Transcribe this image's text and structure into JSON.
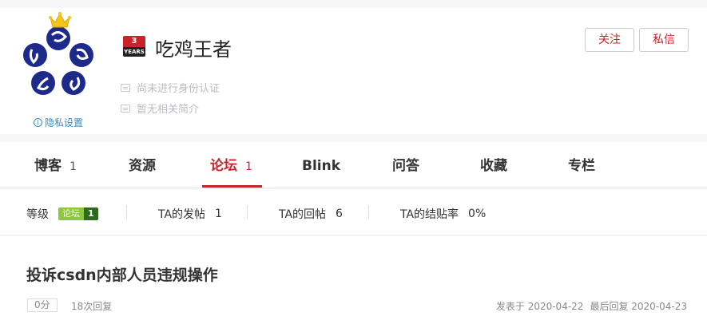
{
  "profile": {
    "username": "吃鸡王者",
    "years_badge": {
      "number": "3",
      "label": "YEARS"
    },
    "verification": "尚未进行身份认证",
    "bio": "暂无相关简介",
    "privacy": "隐私设置",
    "follow_button": "关注",
    "message_button": "私信"
  },
  "tabs": [
    {
      "label": "博客",
      "count": "1"
    },
    {
      "label": "资源",
      "count": ""
    },
    {
      "label": "论坛",
      "count": "1",
      "active": true
    },
    {
      "label": "Blink",
      "count": ""
    },
    {
      "label": "问答",
      "count": ""
    },
    {
      "label": "收藏",
      "count": ""
    },
    {
      "label": "专栏",
      "count": ""
    }
  ],
  "stats": {
    "level_label": "等级",
    "level_badge_text": "论坛",
    "level_badge_num": "1",
    "posts_label": "TA的发帖",
    "posts_value": "1",
    "replies_label": "TA的回帖",
    "replies_value": "6",
    "close_rate_label": "TA的结贴率",
    "close_rate_value": "0%"
  },
  "post": {
    "title": "投诉csdn内部人员违规操作",
    "points": "0分",
    "replies": "18次回复",
    "posted": "发表于 2020-04-22",
    "last_reply": "最后回复 2020-04-23"
  },
  "colors": {
    "accent": "#c9242b",
    "link": "#3a8bc2",
    "avatar_blue": "#1e2a8a",
    "crown": "#f5c518",
    "level_green": "#8dc63f"
  }
}
